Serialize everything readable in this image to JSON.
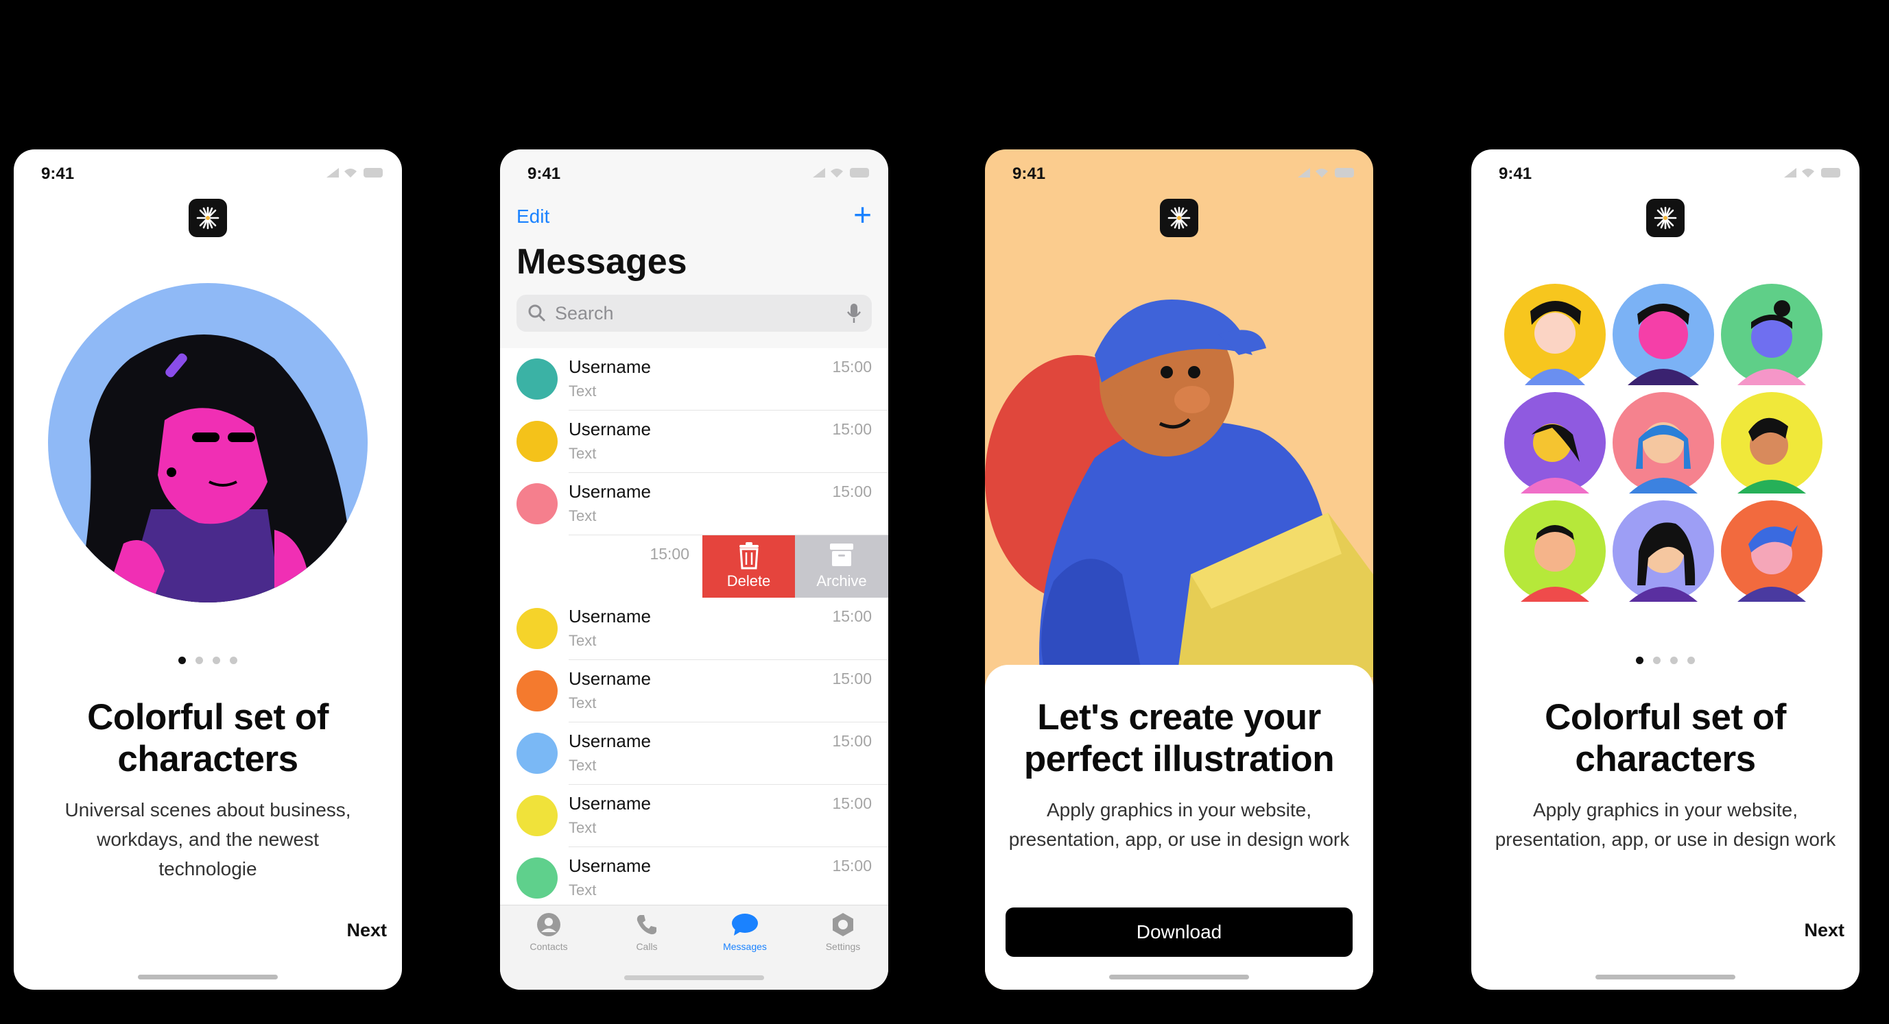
{
  "screens": [
    {
      "status_time": "9:41",
      "title_line1": "Colorful set of",
      "title_line2": "characters",
      "body_line1": "Universal scenes about business,",
      "body_line2": "workdays, and the newest",
      "body_line3": "technologie",
      "next": "Next",
      "pager": {
        "count": 4,
        "active": 1
      }
    },
    {
      "status_time": "9:41",
      "edit": "Edit",
      "plus": "+",
      "title": "Messages",
      "search_placeholder": "Search",
      "rows": [
        {
          "username": "Username",
          "text": "Text",
          "time": "15:00"
        },
        {
          "username": "Username",
          "text": "Text",
          "time": "15:00"
        },
        {
          "username": "Username",
          "text": "Text",
          "time": "15:00"
        },
        {
          "time": "15:00",
          "delete": "Delete",
          "archive": "Archive"
        },
        {
          "username": "Username",
          "text": "Text",
          "time": "15:00"
        },
        {
          "username": "Username",
          "text": "Text",
          "time": "15:00"
        },
        {
          "username": "Username",
          "text": "Text",
          "time": "15:00"
        },
        {
          "username": "Username",
          "text": "Text",
          "time": "15:00"
        },
        {
          "username": "Username",
          "text": "Text",
          "time": "15:00"
        }
      ],
      "tabs": [
        {
          "label": "Contacts",
          "icon": "person-icon"
        },
        {
          "label": "Calls",
          "icon": "phone-icon"
        },
        {
          "label": "Messages",
          "icon": "chat-bubble-icon",
          "active": true
        },
        {
          "label": "Settings",
          "icon": "gear-icon"
        }
      ]
    },
    {
      "status_time": "9:41",
      "title_line1": "Let's create your",
      "title_line2": "perfect illustration",
      "body_line1": "Apply graphics in your website,",
      "body_line2": "presentation, app, or use in design work",
      "button": "Download"
    },
    {
      "status_time": "9:41",
      "title_line1": "Colorful set of",
      "title_line2": "characters",
      "body_line1": "Apply graphics in your website,",
      "body_line2": "presentation, app, or use in design work",
      "next": "Next",
      "pager": {
        "count": 4,
        "active": 1
      }
    }
  ],
  "colors": {
    "accent": "#1a82ff",
    "delete": "#e5443d",
    "archive": "#c7c7cc",
    "illustration_bg": "#fbcc8e"
  }
}
